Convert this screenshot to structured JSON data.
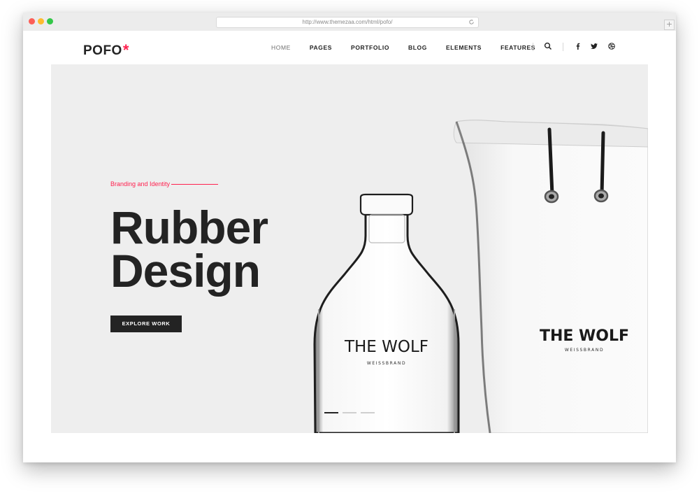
{
  "browser": {
    "url": "http://www.themezaa.com/html/pofo/",
    "new_tab_label": "+"
  },
  "site": {
    "logo_text": "POFO",
    "logo_mark": "*",
    "nav": [
      {
        "label": "HOME",
        "active": true
      },
      {
        "label": "PAGES"
      },
      {
        "label": "PORTFOLIO"
      },
      {
        "label": "BLOG"
      },
      {
        "label": "ELEMENTS"
      },
      {
        "label": "FEATURES"
      }
    ],
    "icons": [
      "search-icon",
      "facebook-icon",
      "twitter-icon",
      "dribbble-icon"
    ]
  },
  "hero": {
    "eyebrow": "Branding and Identity",
    "headline_line1": "Rubber",
    "headline_line2": "Design",
    "cta_label": "EXPLORE WORK",
    "bottle_brand": "THE WOLF",
    "bottle_sub": "WEISSBRAND",
    "bag_brand": "THE WOLF",
    "bag_sub": "WEISSBRAND",
    "slides": 3,
    "active_slide": 1
  },
  "colors": {
    "accent": "#ff214f",
    "dark": "#232323",
    "hero_bg": "#eeeeee"
  }
}
